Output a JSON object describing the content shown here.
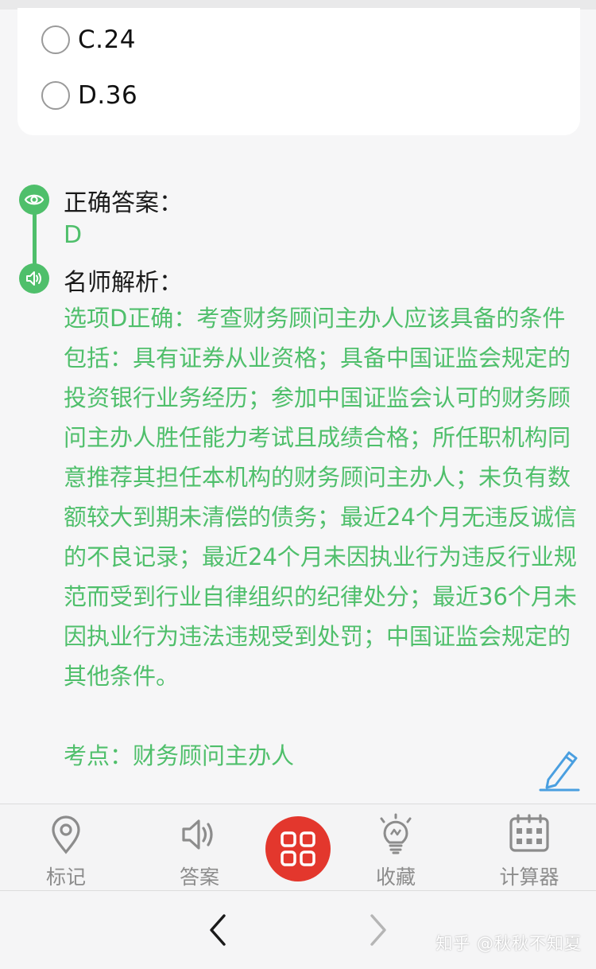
{
  "options": [
    {
      "label": "C.24"
    },
    {
      "label": "D.36"
    }
  ],
  "correct_answer": {
    "title": "正确答案：",
    "value": "D"
  },
  "analysis": {
    "title": "名师解析：",
    "body": "选项D正确：考查财务顾问主办人应该具备的条件包括：具有证券从业资格；具备中国证监会规定的投资银行业务经历；参加中国证监会认可的财务顾问主办人胜任能力考试且成绩合格；所任职机构同意推荐其担任本机构的财务顾问主办人；未负有数额较大到期未清偿的债务；最近24个月无违反诚信的不良记录；最近24个月未因执业行为违反行业规范而受到行业自律组织的纪律处分；最近36个月未因执业行为违法违规受到处罚；中国证监会规定的其他条件。",
    "exam_point": "考点：财务顾问主办人"
  },
  "tabbar": {
    "mark": "标记",
    "answer": "答案",
    "favorite": "收藏",
    "calculator": "计算器"
  },
  "watermark": "知乎 @秋秋不知夏",
  "colors": {
    "accent_green": "#4fbf6b",
    "fab_red": "#e3372d",
    "edit_blue": "#4a9fe0",
    "tab_gray": "#8c8c8c"
  },
  "icons": {
    "answer_section": "eye-icon",
    "analysis_section": "speaker-icon",
    "edit": "pencil-icon",
    "mark": "location-pin-icon",
    "answer": "speaker-icon",
    "center": "grid-icon",
    "favorite": "lightbulb-icon",
    "calculator": "calculator-icon",
    "back": "chevron-left-icon",
    "forward": "chevron-right-icon"
  }
}
